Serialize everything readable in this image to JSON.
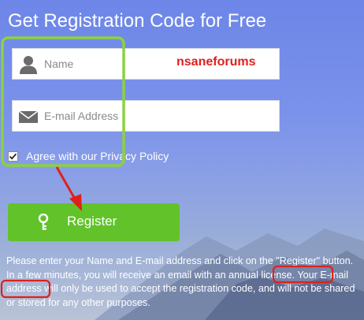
{
  "title": "Get Registration Code for Free",
  "form": {
    "name_placeholder": "Name",
    "email_placeholder": "E-mail Address",
    "agree_label": "Agree with our Privacy Policy",
    "agree_checked": true,
    "register_label": "Register"
  },
  "watermark": "nsaneforums",
  "description": "Please enter your Name and E-mail address and click on the \"Register\" button. In a few minutes, you will receive an email with an annual license. Your E-mail address will only be used to accept the registration code, and will not be shared or stored for any other purposes.",
  "icons": {
    "name": "person-icon",
    "email": "envelope-icon",
    "register": "key-icon"
  },
  "colors": {
    "accent_green": "#62c22a",
    "highlight_box": "#8cd13f",
    "annotation_red": "#e0201c"
  }
}
